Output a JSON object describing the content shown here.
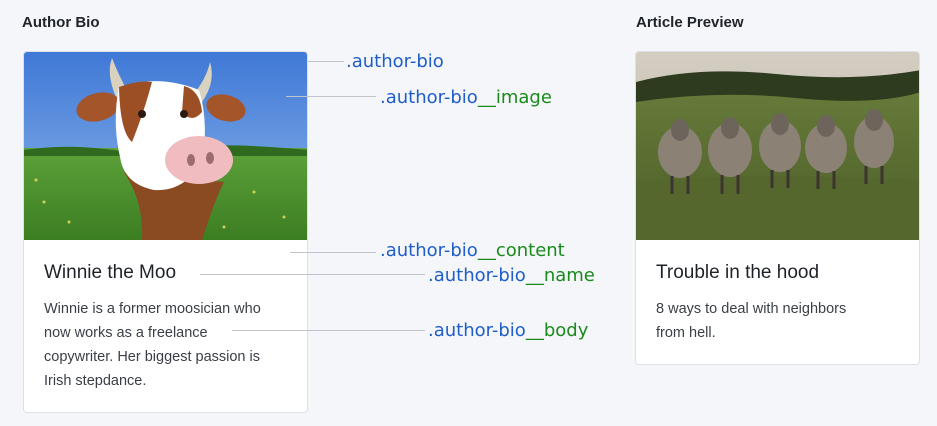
{
  "sections": {
    "author_bio_title": "Author Bio",
    "article_preview_title": "Article Preview"
  },
  "author_card": {
    "name": "Winnie the Moo",
    "body_lines": [
      "Winnie is a former moosician who",
      "now works as a freelance",
      "copywriter. Her biggest passion is",
      "Irish stepdance."
    ]
  },
  "article_card": {
    "name": "Trouble in the hood",
    "body_lines": [
      "8 ways to deal with neighbors",
      "from hell."
    ]
  },
  "annotations": [
    {
      "block": ".author-bio",
      "element": ""
    },
    {
      "block": ".author-bio",
      "element": "__image"
    },
    {
      "block": ".author-bio",
      "element": "__content"
    },
    {
      "block": ".author-bio",
      "element": "__name"
    },
    {
      "block": ".author-bio",
      "element": "__body"
    }
  ],
  "colors": {
    "block_class": "#1f5dc8",
    "element_suffix": "#1a8a1a",
    "page_background": "#f4f6fa"
  }
}
